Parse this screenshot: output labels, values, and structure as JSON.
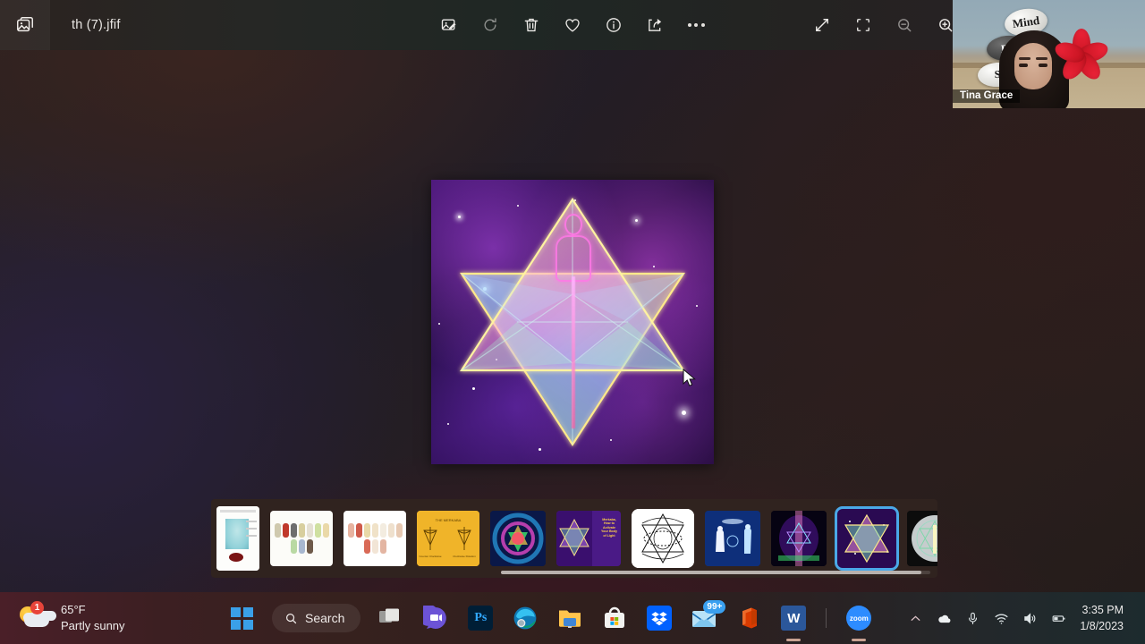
{
  "window": {
    "app_icon": "photos-app-icon",
    "file_title": "th (7).jfif"
  },
  "toolbar": {
    "left_tools": [
      {
        "name": "edit-image-icon",
        "label": "Edit image"
      },
      {
        "name": "rotate-icon",
        "label": "Rotate"
      },
      {
        "name": "delete-icon",
        "label": "Delete"
      },
      {
        "name": "favorite-icon",
        "label": "Add to favorites"
      },
      {
        "name": "info-icon",
        "label": "File info"
      },
      {
        "name": "share-icon",
        "label": "Share"
      },
      {
        "name": "more-options-icon",
        "label": "See more"
      }
    ],
    "right_tools": [
      {
        "name": "fullscreen-icon",
        "label": "Full screen"
      },
      {
        "name": "fit-to-window-icon",
        "label": "Fit to window"
      },
      {
        "name": "zoom-out-icon",
        "label": "Zoom out"
      },
      {
        "name": "zoom-in-icon",
        "label": "Zoom in"
      }
    ]
  },
  "webcam": {
    "participant_name": "Tina Grace",
    "stone_labels": [
      "Mind",
      "Bo",
      "S"
    ]
  },
  "image": {
    "alt": "Merkaba star tetrahedron with meditating light figure on purple cosmic background"
  },
  "filmstrip": {
    "selected_index": 8,
    "scrollbar": {
      "name": "horizontal-scrollbar"
    },
    "thumbnails": [
      {
        "name": "thumbnail-meridian-chart",
        "kind": "chart-portrait",
        "caption": "Meridian chart"
      },
      {
        "name": "thumbnail-body-types-chart",
        "kind": "chart-figures",
        "caption": "Body types chart"
      },
      {
        "name": "thumbnail-emotion-body-chart",
        "kind": "chart-figures2",
        "caption": "Human body emotion chart"
      },
      {
        "name": "thumbnail-yellow-diagram",
        "kind": "yellow",
        "caption": "The merkaba diagram"
      },
      {
        "name": "thumbnail-energy-field",
        "kind": "energy",
        "caption": "Energy field"
      },
      {
        "name": "thumbnail-merkaba-light-body",
        "kind": "merk1",
        "caption": "Merkaba, How to Activate Your Body of Light"
      },
      {
        "name": "thumbnail-merkaba-line-drawing",
        "kind": "white",
        "caption": "Merkaba line drawing"
      },
      {
        "name": "thumbnail-ascension-figures",
        "kind": "blue",
        "caption": "Ascension figures"
      },
      {
        "name": "thumbnail-merkaba-dark",
        "kind": "dark",
        "caption": "Merkaba dark"
      },
      {
        "name": "thumbnail-merkaba-selected",
        "kind": "merk2",
        "caption": "Merkaba star tetrahedron (current)"
      },
      {
        "name": "thumbnail-light-body-sphere",
        "kind": "sphere",
        "caption": "Light body sphere"
      }
    ]
  },
  "taskbar": {
    "weather": {
      "temperature": "65°F",
      "condition": "Partly sunny",
      "badge": "1"
    },
    "search": {
      "label": "Search",
      "icon": "search-icon"
    },
    "apps": [
      {
        "name": "start-button",
        "label": "Start",
        "badge": "",
        "active": false
      },
      {
        "name": "taskview-button",
        "label": "Task view",
        "badge": "",
        "active": false
      },
      {
        "name": "teams-chat-button",
        "label": "Chat",
        "badge": "",
        "active": false
      },
      {
        "name": "photoshop-button",
        "label": "Ps",
        "badge": "",
        "active": false
      },
      {
        "name": "edge-button",
        "label": "Microsoft Edge",
        "badge": "",
        "active": false
      },
      {
        "name": "file-explorer-button",
        "label": "File Explorer",
        "badge": "",
        "active": false
      },
      {
        "name": "microsoft-store-button",
        "label": "Microsoft Store",
        "badge": "",
        "active": false
      },
      {
        "name": "dropbox-button",
        "label": "Dropbox",
        "badge": "",
        "active": false
      },
      {
        "name": "mail-button",
        "label": "Mail",
        "badge": "99+",
        "active": false
      },
      {
        "name": "office-button",
        "label": "Office",
        "badge": "",
        "active": false
      },
      {
        "name": "word-button",
        "label": "W",
        "badge": "",
        "active": true
      },
      {
        "name": "zoom-button",
        "label": "zoom",
        "badge": "",
        "active": true
      }
    ],
    "tray": [
      {
        "name": "show-hidden-icons-chevron",
        "label": "Show hidden icons"
      },
      {
        "name": "onedrive-icon",
        "label": "OneDrive"
      },
      {
        "name": "microphone-icon",
        "label": "Microphone"
      },
      {
        "name": "wifi-icon",
        "label": "Network"
      },
      {
        "name": "volume-icon",
        "label": "Volume"
      },
      {
        "name": "battery-icon",
        "label": "Battery"
      }
    ],
    "clock": {
      "time": "3:35 PM",
      "date": "1/8/2023"
    }
  },
  "colors": {
    "accent": "#4aa8e8",
    "taskbar_left": "#4a1f28",
    "taskbar_right": "#1d2b2e",
    "filmstrip_bg": "#30231f",
    "badge_red": "#e8443a",
    "badge_blue": "#3aa0f0"
  }
}
